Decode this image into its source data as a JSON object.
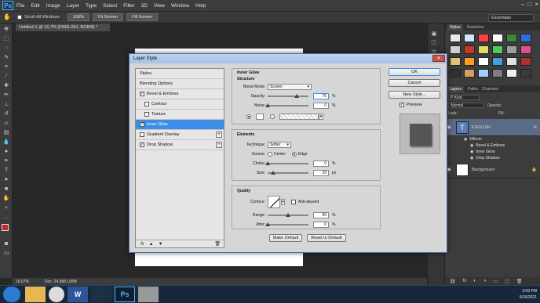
{
  "app": {
    "logo": "Ps"
  },
  "menu": [
    "File",
    "Edit",
    "Image",
    "Layer",
    "Type",
    "Select",
    "Filter",
    "3D",
    "View",
    "Window",
    "Help"
  ],
  "window_controls": [
    "–",
    "□",
    "×"
  ],
  "options_bar": {
    "scroll_all_label": "Scroll All Windows",
    "zoom_btn": "100%",
    "fit_btn": "Fit Screen",
    "fill_btn": "Fill Screen",
    "workspace": "Essentials"
  },
  "document": {
    "tab_title": "Untitled-1 @ 16,7% (ENGLISH, RGB/8) *"
  },
  "status": {
    "zoom": "16.67%",
    "doc": "Doc: 24,9M/1,68M"
  },
  "right_panel": {
    "styles_tabs": [
      "Styles",
      "Swatches"
    ],
    "layers_tabs": [
      "Layers",
      "Paths",
      "Channels"
    ],
    "kind_label": "P Kind",
    "blend": "Normal",
    "opacity_label": "Opacity:",
    "lock_label": "Lock:",
    "fill_label": "Fill:",
    "layers": [
      {
        "name": "ENGLISH",
        "type": "T",
        "fx": "fx"
      },
      {
        "name": "Background",
        "lock": "🔒"
      }
    ],
    "effects": [
      "Effects",
      "Bevel & Emboss",
      "Inner Glow",
      "Drop Shadow"
    ]
  },
  "taskbar": {
    "clock_time": "3:06 PM",
    "clock_date": "6/16/2021"
  },
  "dialog": {
    "title": "Layer Style",
    "close": "✕",
    "list": [
      {
        "label": "Styles",
        "checkbox": false
      },
      {
        "label": "Blending Options",
        "checkbox": false
      },
      {
        "label": "Bevel & Emboss",
        "checkbox": true,
        "checked": true
      },
      {
        "label": "Contour",
        "checkbox": true,
        "checked": false,
        "indent": true
      },
      {
        "label": "Texture",
        "checkbox": true,
        "checked": false,
        "indent": true
      },
      {
        "label": "Inner Glow",
        "checkbox": true,
        "checked": true,
        "selected": true
      },
      {
        "label": "Gradient Overlay",
        "checkbox": true,
        "checked": false,
        "plus": true
      },
      {
        "label": "Drop Shadow",
        "checkbox": true,
        "checked": true,
        "plus": true
      }
    ],
    "list_footer": [
      "fx",
      "▲",
      "▼",
      "🗑"
    ],
    "inner_glow": {
      "title": "Inner Glow",
      "structure": "Structure",
      "blend_mode_label": "Blend Mode:",
      "blend_mode": "Screen",
      "opacity_label": "Opacity:",
      "opacity": "75",
      "noise_label": "Noise:",
      "noise": "0",
      "elements": "Elements",
      "technique_label": "Technique:",
      "technique": "Softer",
      "source_label": "Source:",
      "source_center": "Center",
      "source_edge": "Edge",
      "choke_label": "Choke:",
      "choke": "0",
      "size_label": "Size:",
      "size": "29",
      "quality": "Quality",
      "contour_label": "Contour:",
      "anti_aliased": "Anti-aliased",
      "range_label": "Range:",
      "range": "50",
      "jitter_label": "Jitter:",
      "jitter": "0",
      "unit_pct": "%",
      "unit_px": "px",
      "make_default": "Make Default",
      "reset_default": "Reset to Default"
    },
    "buttons": {
      "ok": "OK",
      "cancel": "Cancel",
      "new_style": "New Style...",
      "preview": "Preview"
    }
  },
  "colors": {
    "accent": "#3d8ee8",
    "dialog_bg": "#d6d6d6",
    "ps_dark": "#282828"
  }
}
